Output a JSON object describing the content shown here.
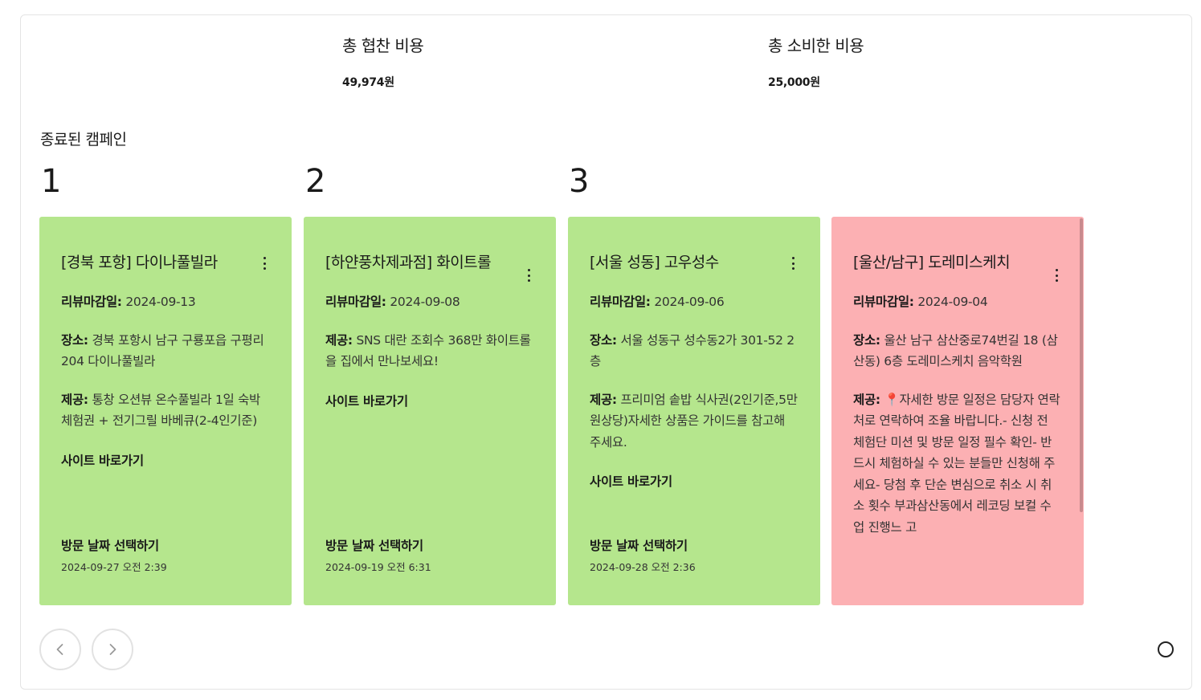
{
  "stats": [
    {
      "label": "총 협찬 비용",
      "value": "49,974원"
    },
    {
      "label": "총 소비한 비용",
      "value": "25,000원"
    }
  ],
  "section_title": "종료된 캠페인",
  "ranks": [
    "1",
    "2",
    "3"
  ],
  "cards": [
    {
      "title": "[경북 포항] 다이나풀빌라",
      "deadline_label": "리뷰마감일:",
      "deadline": "2024-09-13",
      "place_label": "장소:",
      "place": "경북 포항시 남구 구룡포읍 구평리 204 다이나풀빌라",
      "offer_label": "제공:",
      "offer": "통창 오션뷰 온수풀빌라 1일 숙박 체험권 + 전기그릴 바베큐(2-4인기준)",
      "site_link": "사이트 바로가기",
      "visit_label": "방문 날짜 선택하기",
      "visit_date": "2024-09-27 오전 2:39",
      "color": "#b5e68d"
    },
    {
      "title": "[하얀풍차제과점] 화이트롤",
      "deadline_label": "리뷰마감일:",
      "deadline": "2024-09-08",
      "offer_label": "제공:",
      "offer": "SNS 대란 조회수 368만 화이트롤을 집에서 만나보세요!",
      "site_link": "사이트 바로가기",
      "visit_label": "방문 날짜 선택하기",
      "visit_date": "2024-09-19 오전 6:31",
      "color": "#b5e68d"
    },
    {
      "title": "[서울 성동] 고우성수",
      "deadline_label": "리뷰마감일:",
      "deadline": "2024-09-06",
      "place_label": "장소:",
      "place": "서울 성동구 성수동2가 301-52 2층",
      "offer_label": "제공:",
      "offer": "프리미엄 솥밥 식사권(2인기준,5만원상당)자세한 상품은 가이드를 참고해 주세요.",
      "site_link": "사이트 바로가기",
      "visit_label": "방문 날짜 선택하기",
      "visit_date": "2024-09-28 오전 2:36",
      "color": "#b5e68d"
    },
    {
      "title": "[울산/남구] 도레미스케치",
      "deadline_label": "리뷰마감일:",
      "deadline": "2024-09-04",
      "place_label": "장소:",
      "place": "울산 남구 삼산중로74번길 18 (삼산동) 6층 도레미스케치 음악학원",
      "offer_label": "제공:",
      "offer": "📍자세한 방문 일정은 담당자 연락처로 연락하여 조율 바랍니다.- 신청 전 체험단 미션 및 방문 일정 필수 확인- 반드시 체험하실 수 있는 분들만 신청해 주세요- 당첨 후 단순 변심으로 취소 시 취소 횟수 부과삼산동에서 레코딩 보컬 수업 진행느 고",
      "color": "#fcb0b3"
    }
  ],
  "icons": {
    "prev": "chevron-left-icon",
    "next": "chevron-right-icon",
    "menu": "more-vertical-icon",
    "indicator": "circle-icon"
  }
}
